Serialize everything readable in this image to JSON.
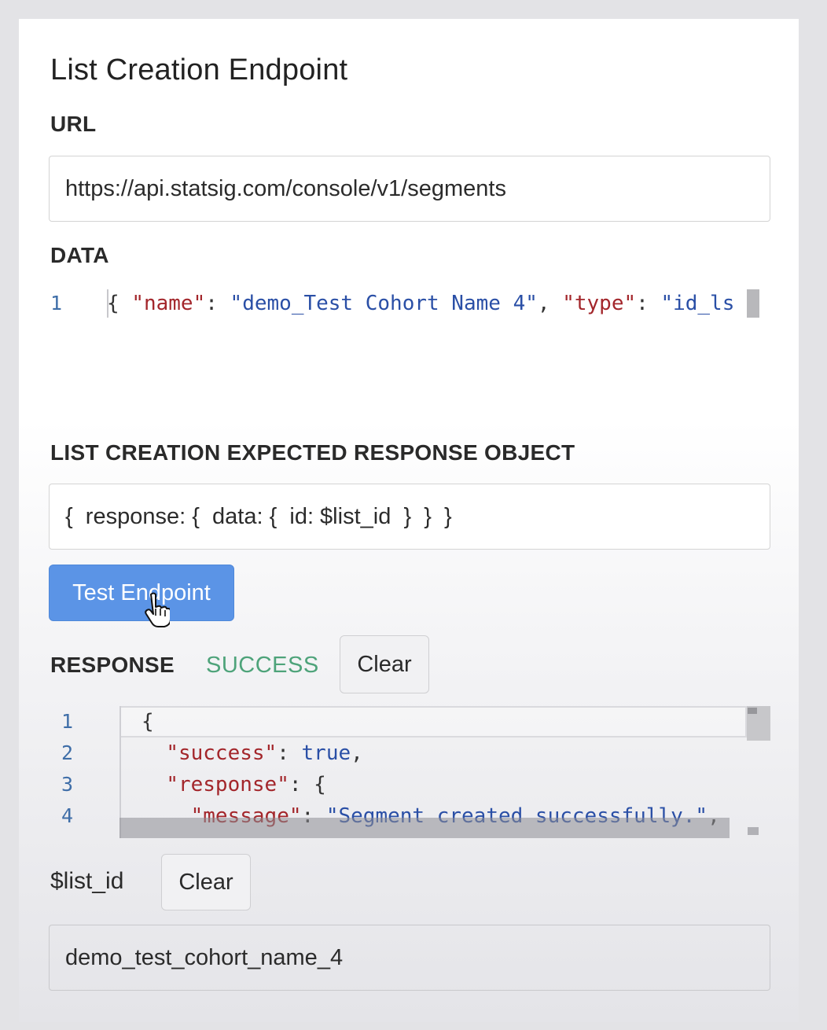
{
  "title": "List Creation Endpoint",
  "url": {
    "label": "URL",
    "value": "https://api.statsig.com/console/v1/segments"
  },
  "data": {
    "label": "DATA",
    "line_number": "1",
    "tokens": {
      "open": "{ ",
      "key1": "\"name\"",
      "sep1": ": ",
      "val1": "\"demo_Test Cohort Name 4\"",
      "sep2": ", ",
      "key2": "\"type\"",
      "sep3": ": ",
      "val2": "\"id_l",
      "tail": "s"
    }
  },
  "expected": {
    "label": "LIST CREATION EXPECTED RESPONSE OBJECT",
    "value": "{  response: {  data: {  id: $list_id  }  }  }"
  },
  "test_button": "Test Endpoint",
  "response": {
    "label": "RESPONSE",
    "status": "SUCCESS",
    "clear": "Clear",
    "lines": [
      {
        "n": "1",
        "indent": "",
        "key": "",
        "punct": "{",
        "value": "",
        "tail": ""
      },
      {
        "n": "2",
        "indent": "  ",
        "key": "\"success\"",
        "punct": ": ",
        "value": "true",
        "tail": ","
      },
      {
        "n": "3",
        "indent": "  ",
        "key": "\"response\"",
        "punct": ": ",
        "value": "",
        "tail": "{"
      },
      {
        "n": "4",
        "indent": "    ",
        "key": "\"message\"",
        "punct": ": ",
        "value": "\"Segment created successfully.\"",
        "tail": ","
      }
    ]
  },
  "list_id": {
    "label": "$list_id",
    "clear": "Clear",
    "value": "demo_test_cohort_name_4"
  },
  "colors": {
    "primary_button": "#5b94e6",
    "success": "#4ea37a",
    "json_key": "#a3262b",
    "json_string": "#2a4fa6"
  }
}
